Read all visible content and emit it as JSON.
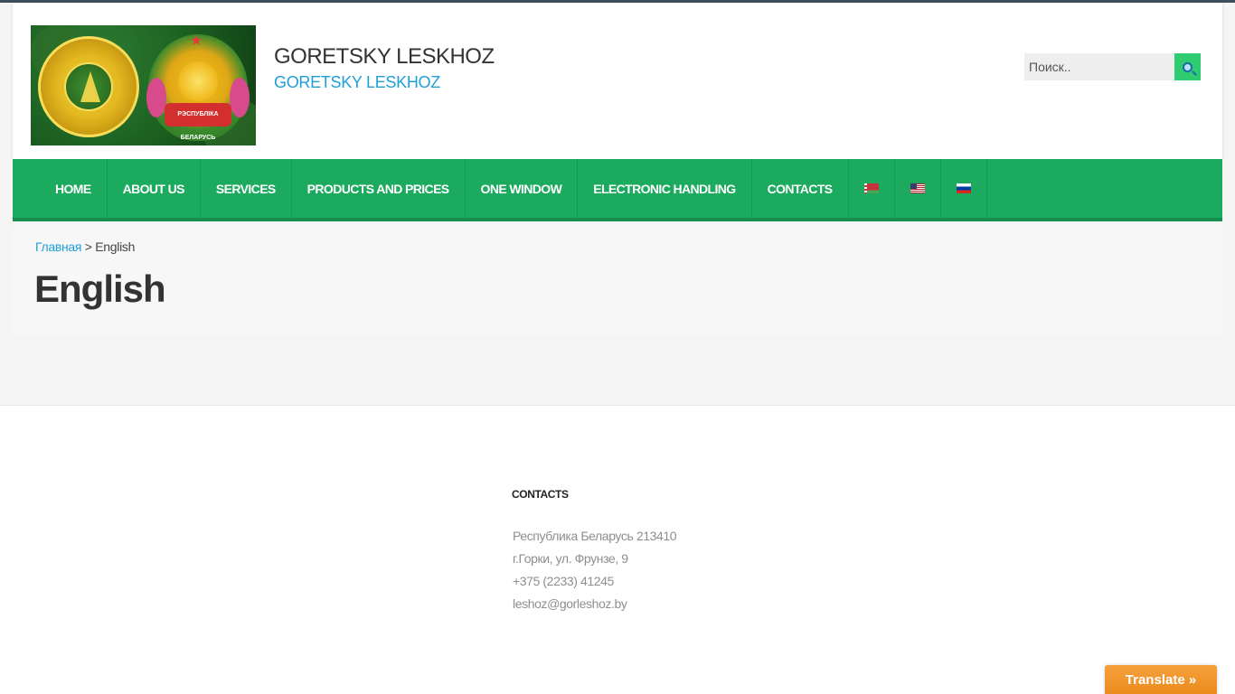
{
  "header": {
    "site_title": "GORETSKY LESKHOZ",
    "site_subtitle": "GORETSKY LESKHOZ",
    "logo_text": "РЭСПУБЛІКА БЕЛАРУСЬ"
  },
  "search": {
    "placeholder": "Поиск.."
  },
  "nav": {
    "items": [
      {
        "label": "HOME"
      },
      {
        "label": "ABOUT US"
      },
      {
        "label": "SERVICES"
      },
      {
        "label": "PRODUCTS AND PRICES"
      },
      {
        "label": "ONE WINDOW"
      },
      {
        "label": "ELECTRONIC HANDLING"
      },
      {
        "label": "CONTACTS"
      }
    ],
    "flags": [
      "belarus-flag-icon",
      "usa-flag-icon",
      "russia-flag-icon"
    ]
  },
  "breadcrumb": {
    "home": "Главная",
    "separator": " > ",
    "current": "English"
  },
  "page": {
    "title": "English"
  },
  "footer": {
    "contacts_heading": "CONTACTS",
    "lines": [
      "Республика Беларусь 213410",
      "г.Горки, ул. Фрунзе, 9",
      "+375 (2233) 41245",
      "leshoz@gorleshoz.by"
    ]
  },
  "translate": {
    "label": "Translate »"
  },
  "colors": {
    "nav_green": "#1baa5e",
    "accent_blue": "#1e9fd8",
    "search_button": "#2ecc71",
    "translate_orange": "#ea8b1d"
  }
}
